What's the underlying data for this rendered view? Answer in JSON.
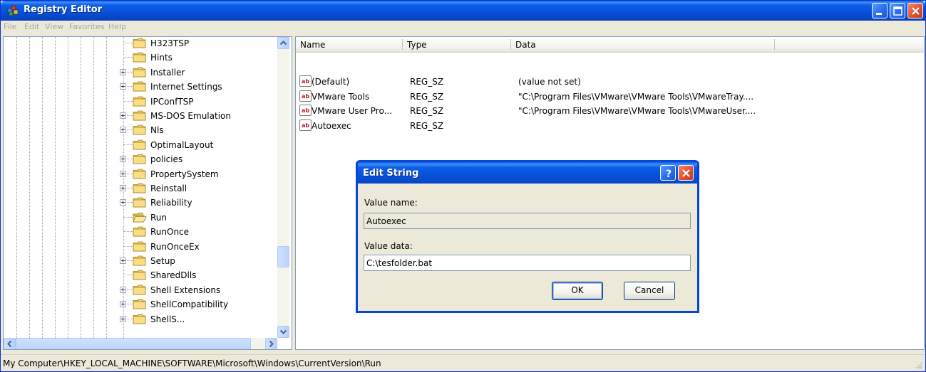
{
  "window": {
    "title": "Registry Editor",
    "icon": "registry-editor-icon"
  },
  "menu": [
    "File",
    "Edit",
    "View",
    "Favorites",
    "Help"
  ],
  "tree": {
    "items": [
      {
        "label": "H323TSP",
        "expandable": false,
        "open": false
      },
      {
        "label": "Hints",
        "expandable": false,
        "open": false
      },
      {
        "label": "Installer",
        "expandable": true,
        "open": false
      },
      {
        "label": "Internet Settings",
        "expandable": true,
        "open": false
      },
      {
        "label": "IPConfTSP",
        "expandable": false,
        "open": false
      },
      {
        "label": "MS-DOS Emulation",
        "expandable": true,
        "open": false
      },
      {
        "label": "Nls",
        "expandable": true,
        "open": false
      },
      {
        "label": "OptimalLayout",
        "expandable": false,
        "open": false
      },
      {
        "label": "policies",
        "expandable": true,
        "open": false
      },
      {
        "label": "PropertySystem",
        "expandable": true,
        "open": false
      },
      {
        "label": "Reinstall",
        "expandable": true,
        "open": false
      },
      {
        "label": "Reliability",
        "expandable": true,
        "open": false
      },
      {
        "label": "Run",
        "expandable": false,
        "open": true
      },
      {
        "label": "RunOnce",
        "expandable": false,
        "open": false
      },
      {
        "label": "RunOnceEx",
        "expandable": false,
        "open": false
      },
      {
        "label": "Setup",
        "expandable": true,
        "open": false
      },
      {
        "label": "SharedDlls",
        "expandable": false,
        "open": false
      },
      {
        "label": "Shell Extensions",
        "expandable": true,
        "open": false
      },
      {
        "label": "ShellCompatibility",
        "expandable": true,
        "open": false
      },
      {
        "label": "ShellS...",
        "expandable": true,
        "open": false
      }
    ]
  },
  "list": {
    "columns": [
      "Name",
      "Type",
      "Data"
    ],
    "rows": [
      {
        "name": "(Default)",
        "type": "REG_SZ",
        "data": "(value not set)"
      },
      {
        "name": "VMware Tools",
        "type": "REG_SZ",
        "data": "\"C:\\Program Files\\VMware\\VMware Tools\\VMwareTray...."
      },
      {
        "name": "VMware User Pro...",
        "type": "REG_SZ",
        "data": "\"C:\\Program Files\\VMware\\VMware Tools\\VMwareUser...."
      },
      {
        "name": "Autoexec",
        "type": "REG_SZ",
        "data": ""
      }
    ]
  },
  "dialog": {
    "title": "Edit String",
    "help_glyph": "?",
    "value_name_label": "Value name:",
    "value_name": "Autoexec",
    "value_data_label": "Value data:",
    "value_data": "C:\\tesfolder.bat",
    "ok_label": "OK",
    "cancel_label": "Cancel"
  },
  "statusbar": {
    "path": "My Computer\\HKEY_LOCAL_MACHINE\\SOFTWARE\\Microsoft\\Windows\\CurrentVersion\\Run"
  },
  "colors": {
    "title_blue": "#0851da",
    "close_red": "#e0532e",
    "window_bg": "#ece9d8"
  }
}
